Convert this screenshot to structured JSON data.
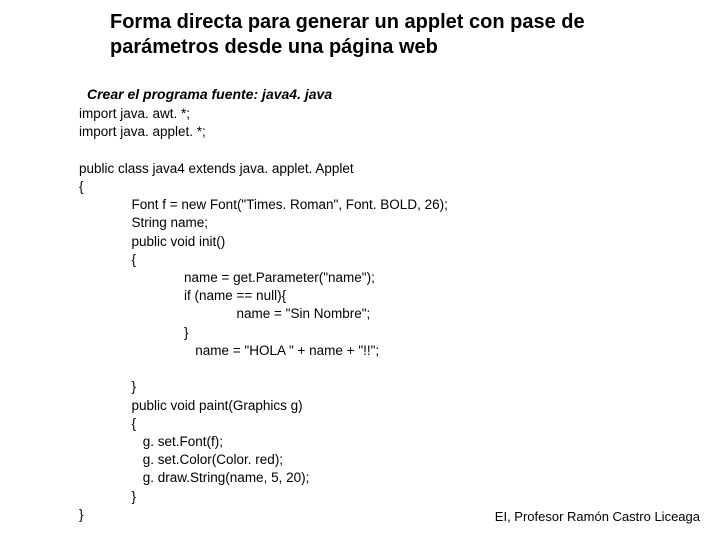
{
  "title": "Forma directa para generar un applet con pase de parámetros  desde una página web",
  "subtitle": "Crear el programa fuente: java4. java",
  "code": "import java. awt. *;\nimport java. applet. *;\n\npublic class java4 extends java. applet. Applet\n{\n              Font f = new Font(\"Times. Roman\", Font. BOLD, 26);\n              String name;\n              public void init()\n              {\n                            name = get.Parameter(\"name\");\n                            if (name == null){\n                                          name = \"Sin Nombre\";\n                            }\n                               name = \"HOLA \" + name + \"!!\";\n\n              }\n              public void paint(Graphics g)\n              {\n                 g. set.Font(f);\n                 g. set.Color(Color. red);\n                 g. draw.String(name, 5, 20);\n              }\n}",
  "footer": "EI, Profesor Ramón Castro Liceaga"
}
